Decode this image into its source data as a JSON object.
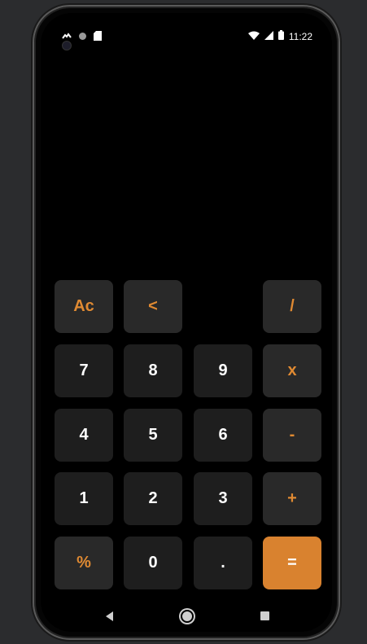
{
  "status_bar": {
    "time": "11:22",
    "left_icons": [
      "notification-icon",
      "circle-status-icon",
      "sd-card-icon"
    ],
    "right_icons": [
      "wifi-icon",
      "signal-icon",
      "battery-icon"
    ]
  },
  "keypad": {
    "colors": {
      "operator_text": "#e08a32",
      "operator_bg": "#292929",
      "number_bg": "#1e1e1e",
      "equals_bg": "#d9822f"
    },
    "rows": [
      [
        "Ac",
        "<",
        "",
        "/"
      ],
      [
        "7",
        "8",
        "9",
        "x"
      ],
      [
        "4",
        "5",
        "6",
        "-"
      ],
      [
        "1",
        "2",
        "3",
        "+"
      ],
      [
        "%",
        "0",
        ".",
        "="
      ]
    ]
  },
  "nav_bar": {
    "icons": [
      "back-icon",
      "home-icon",
      "recents-icon"
    ]
  }
}
